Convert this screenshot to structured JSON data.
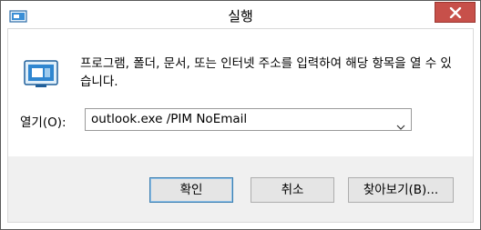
{
  "window": {
    "title": "실행"
  },
  "icons": {
    "app": "run-icon",
    "close": "close-icon",
    "dropdown": "chevron-down-icon"
  },
  "description": "프로그램, 폴더, 문서, 또는 인터넷 주소를 입력하여 해당 항목을 열 수 있습니다.",
  "open_label": "열기(O):",
  "combo": {
    "value": "outlook.exe /PIM NoEmail"
  },
  "buttons": {
    "ok": "확인",
    "cancel": "취소",
    "browse": "찾아보기(B)..."
  },
  "colors": {
    "close": "#c7504a",
    "footer": "#f0f0f0",
    "ok_border": "#3c7fb1"
  }
}
